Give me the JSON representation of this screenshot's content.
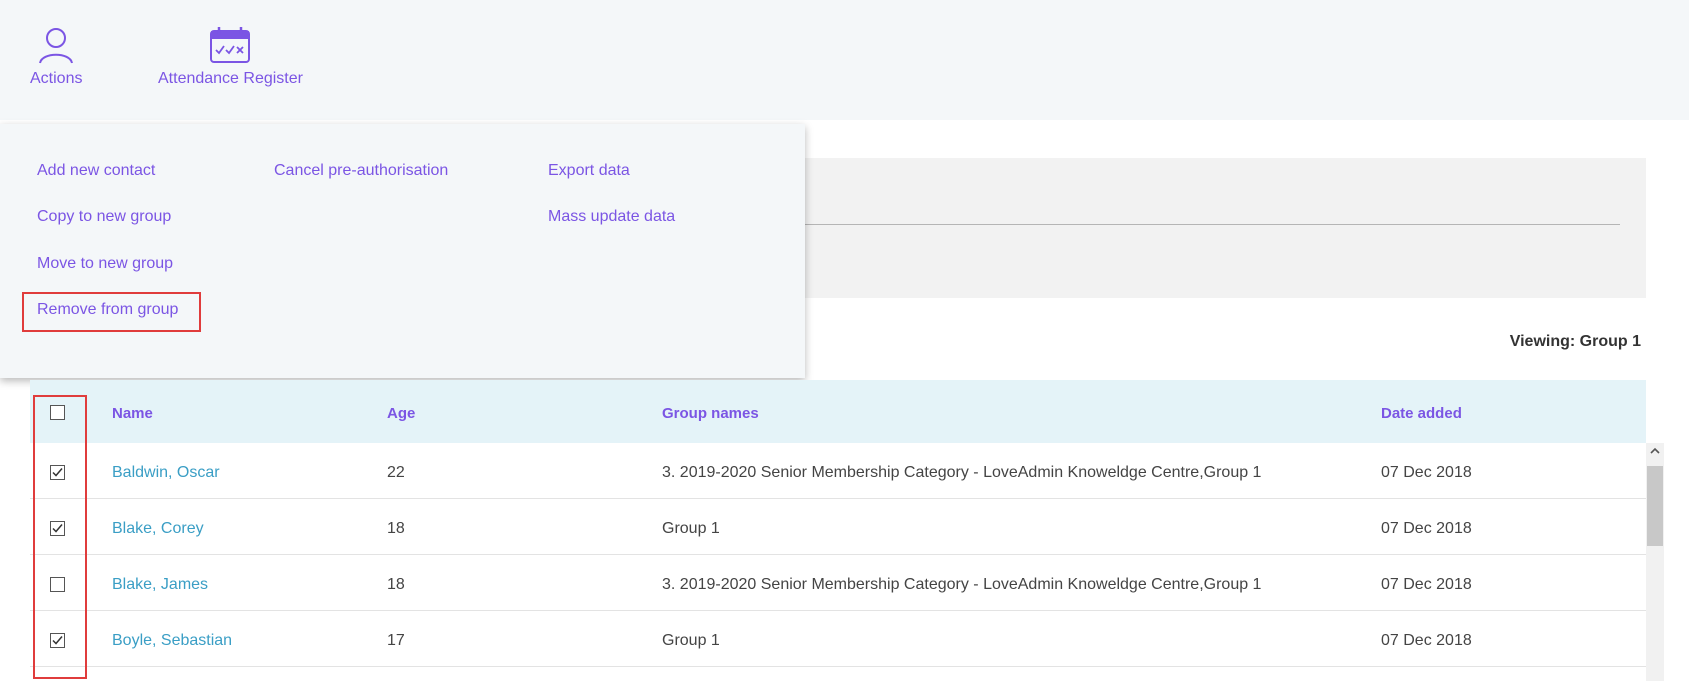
{
  "toolbar": {
    "actions_label": "Actions",
    "register_label": "Attendance Register"
  },
  "menu": {
    "col1": [
      "Add new contact",
      "Copy to new group",
      "Move to new group",
      "Remove from group"
    ],
    "col2": [
      "Cancel pre-authorisation"
    ],
    "col3": [
      "Export data",
      "Mass update data"
    ]
  },
  "viewing": "Viewing: Group 1",
  "table": {
    "headers": {
      "name": "Name",
      "age": "Age",
      "groups": "Group names",
      "date": "Date added"
    },
    "header_checked": false,
    "rows": [
      {
        "checked": true,
        "name": "Baldwin, Oscar",
        "age": "22",
        "groups": "3. 2019-2020 Senior Membership Category - LoveAdmin Knoweldge Centre,Group 1",
        "date": "07 Dec 2018"
      },
      {
        "checked": true,
        "name": "Blake, Corey",
        "age": "18",
        "groups": "Group 1",
        "date": "07 Dec 2018"
      },
      {
        "checked": false,
        "name": "Blake, James",
        "age": "18",
        "groups": "3. 2019-2020 Senior Membership Category - LoveAdmin Knoweldge Centre,Group 1",
        "date": "07 Dec 2018"
      },
      {
        "checked": true,
        "name": "Boyle, Sebastian",
        "age": "17",
        "groups": "Group 1",
        "date": "07 Dec 2018"
      }
    ]
  },
  "colors": {
    "accent": "#7b55e4",
    "link": "#3a9ec5",
    "highlight": "#e03c3c"
  }
}
